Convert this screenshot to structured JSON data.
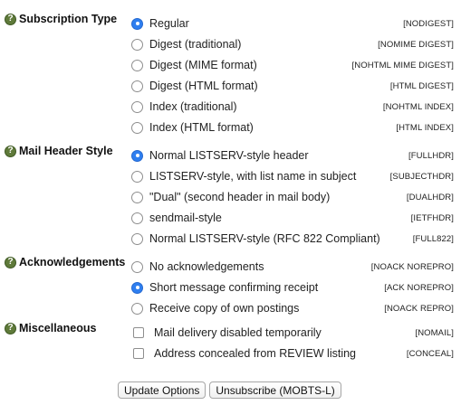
{
  "sections": [
    {
      "title": "Subscription Type",
      "control": "radio",
      "options": [
        {
          "label": "Regular",
          "code": "[NODIGEST]",
          "selected": true
        },
        {
          "label": "Digest (traditional)",
          "code": "[NOMIME DIGEST]",
          "selected": false
        },
        {
          "label": "Digest (MIME format)",
          "code": "[NOHTML MIME DIGEST]",
          "selected": false
        },
        {
          "label": "Digest (HTML format)",
          "code": "[HTML DIGEST]",
          "selected": false
        },
        {
          "label": "Index (traditional)",
          "code": "[NOHTML INDEX]",
          "selected": false
        },
        {
          "label": "Index (HTML format)",
          "code": "[HTML INDEX]",
          "selected": false
        }
      ]
    },
    {
      "title": "Mail Header Style",
      "control": "radio",
      "options": [
        {
          "label": "Normal LISTSERV-style header",
          "code": "[FULLHDR]",
          "selected": true
        },
        {
          "label": "LISTSERV-style, with list name in subject",
          "code": "[SUBJECTHDR]",
          "selected": false
        },
        {
          "label": "\"Dual\" (second header in mail body)",
          "code": "[DUALHDR]",
          "selected": false
        },
        {
          "label": "sendmail-style",
          "code": "[IETFHDR]",
          "selected": false
        },
        {
          "label": "Normal LISTSERV-style (RFC 822 Compliant)",
          "code": "[FULL822]",
          "selected": false
        }
      ]
    },
    {
      "title": "Acknowledgements",
      "control": "radio",
      "options": [
        {
          "label": "No acknowledgements",
          "code": "[NOACK NOREPRO]",
          "selected": false
        },
        {
          "label": "Short message confirming receipt",
          "code": "[ACK NOREPRO]",
          "selected": true
        },
        {
          "label": "Receive copy of own postings",
          "code": "[NOACK REPRO]",
          "selected": false
        }
      ]
    },
    {
      "title": "Miscellaneous",
      "control": "checkbox",
      "options": [
        {
          "label": "Mail delivery disabled temporarily",
          "code": "[NOMAIL]",
          "selected": false
        },
        {
          "label": "Address concealed from REVIEW listing",
          "code": "[CONCEAL]",
          "selected": false
        }
      ]
    }
  ],
  "help_icon_glyph": "?",
  "buttons": {
    "update": "Update Options",
    "unsubscribe": "Unsubscribe (MOBTS-L)"
  }
}
